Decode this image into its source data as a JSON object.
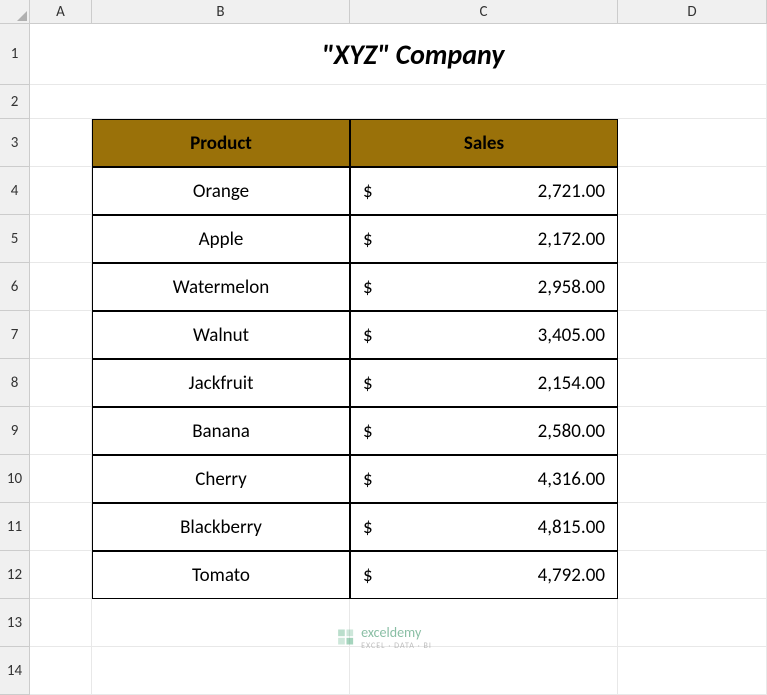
{
  "columns": [
    "A",
    "B",
    "C",
    "D"
  ],
  "rows": [
    "1",
    "2",
    "3",
    "4",
    "5",
    "6",
    "7",
    "8",
    "9",
    "10",
    "11",
    "12",
    "13",
    "14"
  ],
  "title": "\"XYZ\" Company",
  "headers": {
    "product": "Product",
    "sales": "Sales"
  },
  "currency": "$",
  "products": [
    {
      "name": "Orange",
      "sales": "2,721.00"
    },
    {
      "name": "Apple",
      "sales": "2,172.00"
    },
    {
      "name": "Watermelon",
      "sales": "2,958.00"
    },
    {
      "name": "Walnut",
      "sales": "3,405.00"
    },
    {
      "name": "Jackfruit",
      "sales": "2,154.00"
    },
    {
      "name": "Banana",
      "sales": "2,580.00"
    },
    {
      "name": "Cherry",
      "sales": "4,316.00"
    },
    {
      "name": "Blackberry",
      "sales": "4,815.00"
    },
    {
      "name": "Tomato",
      "sales": "4,792.00"
    }
  ],
  "watermark": {
    "name": "exceldemy",
    "sub": "EXCEL · DATA · BI"
  },
  "colors": {
    "header_bg": "#9a7109"
  }
}
